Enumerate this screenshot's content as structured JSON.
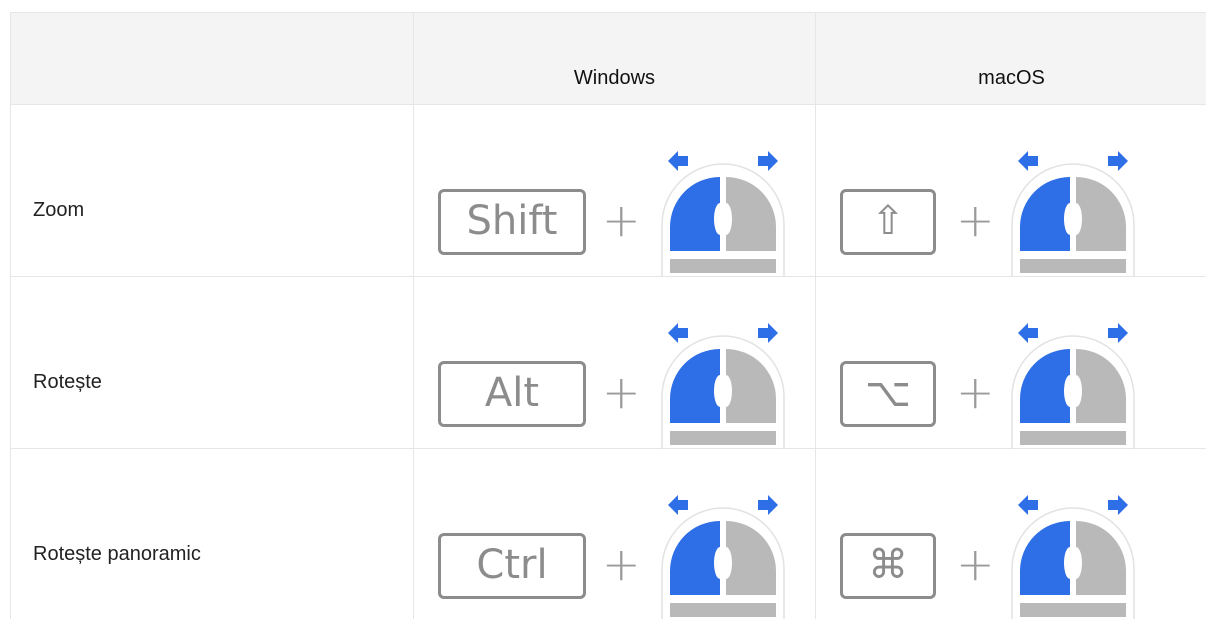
{
  "table": {
    "headers": [
      "",
      "Windows",
      "macOS"
    ],
    "rows": [
      {
        "action": "Zoom",
        "windows_key": "Shift",
        "mac_key": "⇧",
        "mac_key_icon": "shift-icon"
      },
      {
        "action": "Rotește",
        "windows_key": "Alt",
        "mac_key": "⌥",
        "mac_key_icon": "option-icon"
      },
      {
        "action": "Rotește panoramic",
        "windows_key": "Ctrl",
        "mac_key": "⌘",
        "mac_key_icon": "command-icon"
      }
    ],
    "plus": "+",
    "mouse_icon": "mouse-left-drag-icon",
    "colors": {
      "accent_blue": "#2e6ee6",
      "mouse_gray": "#b9b9b9",
      "key_gray": "#8c8c8c",
      "header_bg": "#f4f4f4",
      "border": "#e6e6e6"
    }
  }
}
